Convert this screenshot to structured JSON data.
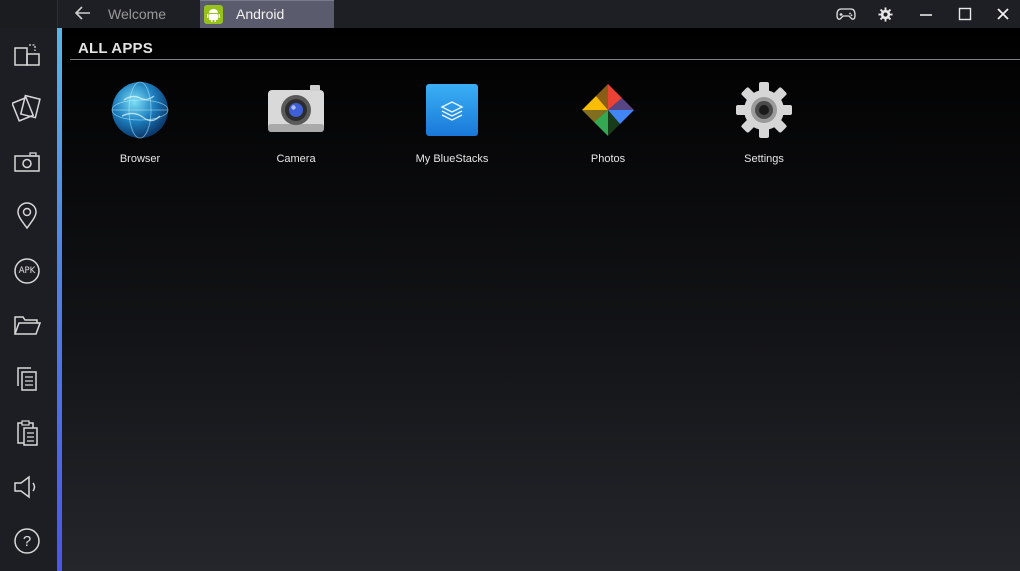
{
  "window": {
    "tabs": [
      {
        "label": "Welcome",
        "active": false
      },
      {
        "label": "Android",
        "active": true
      }
    ]
  },
  "toolbar": {
    "icons": [
      "back-arrow-icon",
      "gamepad-icon",
      "gear-icon",
      "minimize-icon",
      "maximize-icon",
      "close-icon"
    ]
  },
  "sidebar": {
    "items": [
      {
        "icon": "rotate-screen-icon"
      },
      {
        "icon": "shake-icon"
      },
      {
        "icon": "camera-icon"
      },
      {
        "icon": "location-pin-icon"
      },
      {
        "icon": "apk-icon",
        "label": "APK"
      },
      {
        "icon": "folder-icon"
      },
      {
        "icon": "copy-icon"
      },
      {
        "icon": "paste-icon"
      },
      {
        "icon": "volume-icon"
      },
      {
        "icon": "help-icon",
        "label": "?"
      }
    ]
  },
  "main": {
    "title": "ALL APPS",
    "apps": [
      {
        "label": "Browser",
        "icon": "globe-icon"
      },
      {
        "label": "Camera",
        "icon": "camera-app-icon"
      },
      {
        "label": "My BlueStacks",
        "icon": "bluestacks-icon"
      },
      {
        "label": "Photos",
        "icon": "pinwheel-icon"
      },
      {
        "label": "Settings",
        "icon": "settings-gear-icon"
      }
    ]
  },
  "colors": {
    "accent_top": "#57b8e8",
    "accent_bottom": "#4a56e8",
    "active_tab": "#5b5b6e",
    "android_green": "#97c11f"
  }
}
